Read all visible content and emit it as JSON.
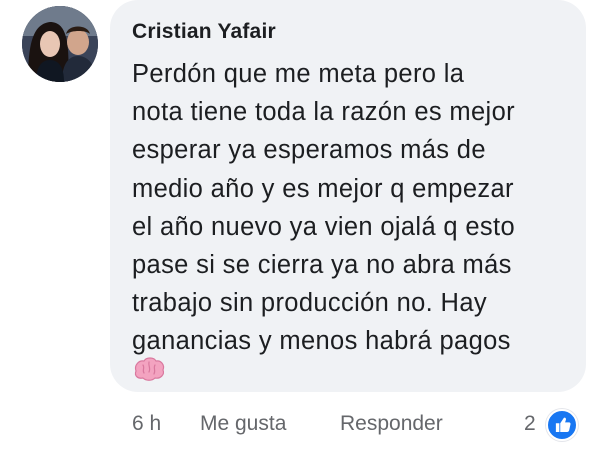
{
  "comment": {
    "author": "Cristian Yafair",
    "text": "Perdón que me meta pero la\nnota tiene toda la razón es mejor\nesperar ya esperamos más de\nmedio año y es mejor q empezar\nel año nuevo ya vien ojalá q esto\npase si se cierra ya no abra más\ntrabajo sin producción no. Hay\nganancias y menos habrá pagos",
    "emoji": "brain-emoji"
  },
  "actions": {
    "time": "6 h",
    "like_label": "Me gusta",
    "reply_label": "Responder",
    "reaction_count": "2",
    "reaction_icon": "thumbs-up-icon"
  },
  "colors": {
    "bubble": "#f0f2f5",
    "text": "#1c1e21",
    "muted": "#65676b",
    "like_blue": "#1877f2"
  }
}
